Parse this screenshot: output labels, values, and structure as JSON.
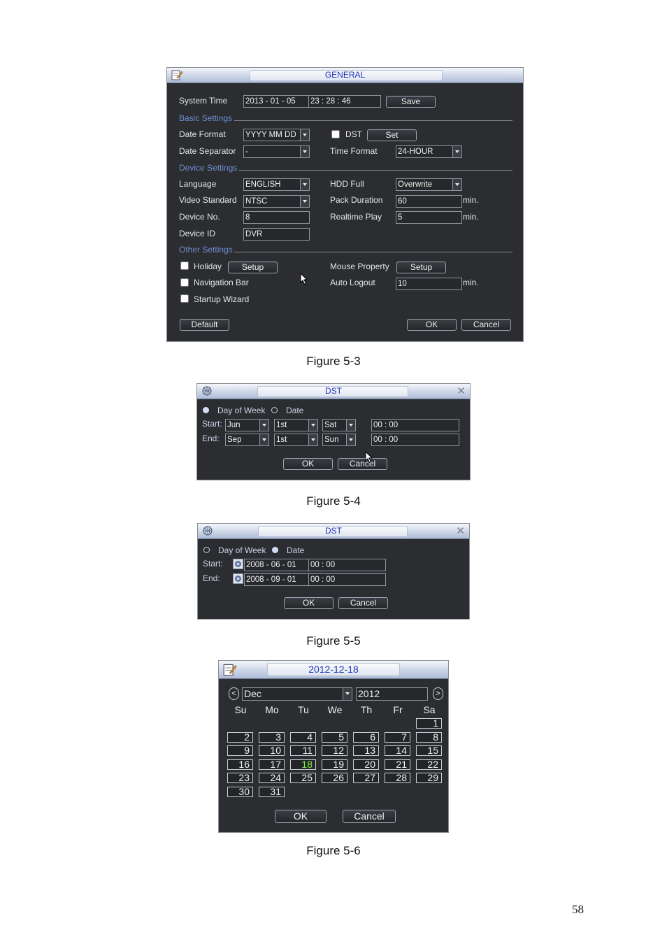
{
  "general": {
    "title": "GENERAL",
    "system_time_label": "System Time",
    "system_date_value": "2013  - 01 - 05",
    "system_clock_value": "23 : 28 : 46",
    "save_label": "Save",
    "basic_settings": "Basic Settings",
    "date_format_label": "Date Format",
    "date_format_value": "YYYY MM DD",
    "dst_label": "DST",
    "dst_set_label": "Set",
    "date_separator_label": "Date Separator",
    "date_separator_value": "-",
    "time_format_label": "Time Format",
    "time_format_value": "24-HOUR",
    "device_settings": "Device Settings",
    "language_label": "Language",
    "language_value": "ENGLISH",
    "hdd_full_label": "HDD Full",
    "hdd_full_value": "Overwrite",
    "video_standard_label": "Video Standard",
    "video_standard_value": "NTSC",
    "pack_duration_label": "Pack Duration",
    "pack_duration_value": "60",
    "min_unit": "min.",
    "device_no_label": "Device No.",
    "device_no_value": "8",
    "realtime_play_label": "Realtime Play",
    "realtime_play_value": "5",
    "device_id_label": "Device ID",
    "device_id_value": "DVR",
    "other_settings": "Other Settings",
    "holiday_label": "Holiday",
    "holiday_setup_label": "Setup",
    "mouse_property_label": "Mouse Property",
    "mouse_setup_label": "Setup",
    "navigation_bar_label": "Navigation Bar",
    "auto_logout_label": "Auto Logout",
    "auto_logout_value": "10",
    "startup_wizard_label": "Startup Wizard",
    "default_label": "Default",
    "ok_label": "OK",
    "cancel_label": "Cancel"
  },
  "caption_1": "Figure 5-3",
  "dst_week": {
    "title": "DST",
    "day_of_week_label": "Day of Week",
    "date_label": "Date",
    "start_label": "Start:",
    "end_label": "End:",
    "start_month": "Jun",
    "start_week": "1st",
    "start_day": "Sat",
    "start_time": "00  :  00",
    "end_month": "Sep",
    "end_week": "1st",
    "end_day": "Sun",
    "end_time": "00  :  00",
    "ok_label": "OK",
    "cancel_label": "Cancel"
  },
  "caption_2": "Figure 5-4",
  "dst_date": {
    "title": "DST",
    "day_of_week_label": "Day of Week",
    "date_label": "Date",
    "start_label": "Start:",
    "end_label": "End:",
    "start_date": "2008  - 06 - 01",
    "start_time": "00 : 00",
    "end_date": "2008  - 09 - 01",
    "end_time": "00 : 00",
    "ok_label": "OK",
    "cancel_label": "Cancel"
  },
  "caption_3": "Figure 5-5",
  "calendar": {
    "title": "2012-12-18",
    "prev": "<",
    "next": ">",
    "month": "Dec",
    "year": "2012",
    "weekdays": [
      "Su",
      "Mo",
      "Tu",
      "We",
      "Th",
      "Fr",
      "Sa"
    ],
    "first_weekday_index": 6,
    "days_in_month": 31,
    "today": 18,
    "ok_label": "OK",
    "cancel_label": "Cancel"
  },
  "caption_4": "Figure 5-6",
  "page_number": "58"
}
